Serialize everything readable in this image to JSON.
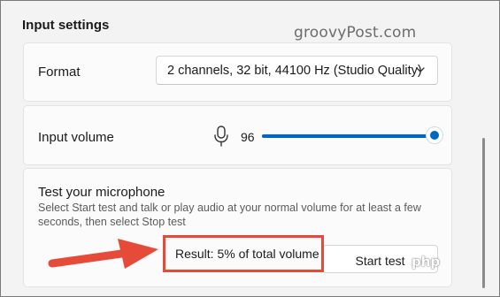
{
  "section": {
    "title": "Input settings"
  },
  "watermark": {
    "text": "groovyPost.com"
  },
  "format": {
    "label": "Format",
    "dropdown_value": "2 channels, 32 bit, 44100 Hz (Studio Quality)",
    "icon": "chevron-down-icon"
  },
  "volume": {
    "label": "Input volume",
    "value": "96",
    "level_percent": 96,
    "icon": "microphone-icon",
    "accent": "#0067c0"
  },
  "test": {
    "title": "Test your microphone",
    "description": "Select Start test and talk or play audio at your normal volume for at least a few seconds, then select Stop test",
    "result": "Result: 5% of total volume",
    "button_label": "Start test"
  },
  "annotation": {
    "color": "#e64b3a"
  },
  "badge": {
    "text": "php"
  }
}
